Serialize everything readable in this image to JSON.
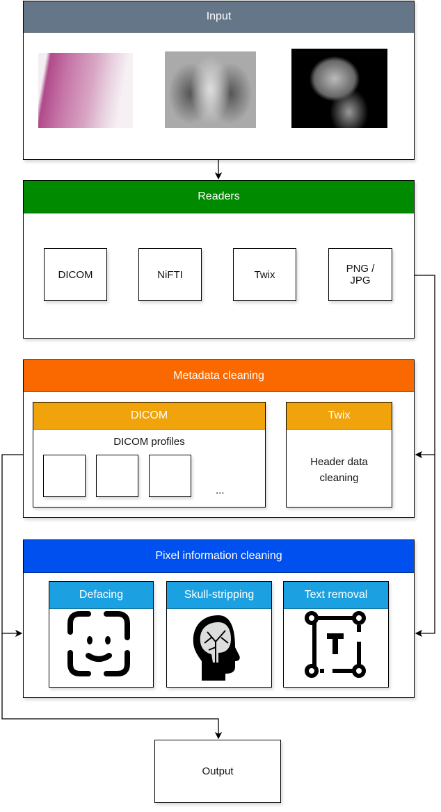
{
  "input": {
    "title": "Input",
    "color": "#647687",
    "images": [
      "histology-slide",
      "chest-xray",
      "brain-mri-sagittal"
    ]
  },
  "readers": {
    "title": "Readers",
    "color": "#008a00",
    "items": [
      "DICOM",
      "NiFTI",
      "Twix",
      "PNG / JPG"
    ]
  },
  "metadata": {
    "title": "Metadata cleaning",
    "color": "#fa6800",
    "dicom": {
      "title": "DICOM",
      "color": "#f0a30a",
      "profiles_label": "DICOM profiles",
      "ellipsis": "..."
    },
    "twix": {
      "title": "Twix",
      "color": "#f0a30a",
      "body": "Header data cleaning"
    }
  },
  "pixel": {
    "title": "Pixel information cleaning",
    "color": "#0050ef",
    "sub_color": "#1ba1e2",
    "items": [
      {
        "title": "Defacing",
        "icon": "face-scan-icon"
      },
      {
        "title": "Skull-stripping",
        "icon": "brain-head-icon"
      },
      {
        "title": "Text removal",
        "icon": "text-box-icon"
      }
    ]
  },
  "output": {
    "label": "Output"
  }
}
